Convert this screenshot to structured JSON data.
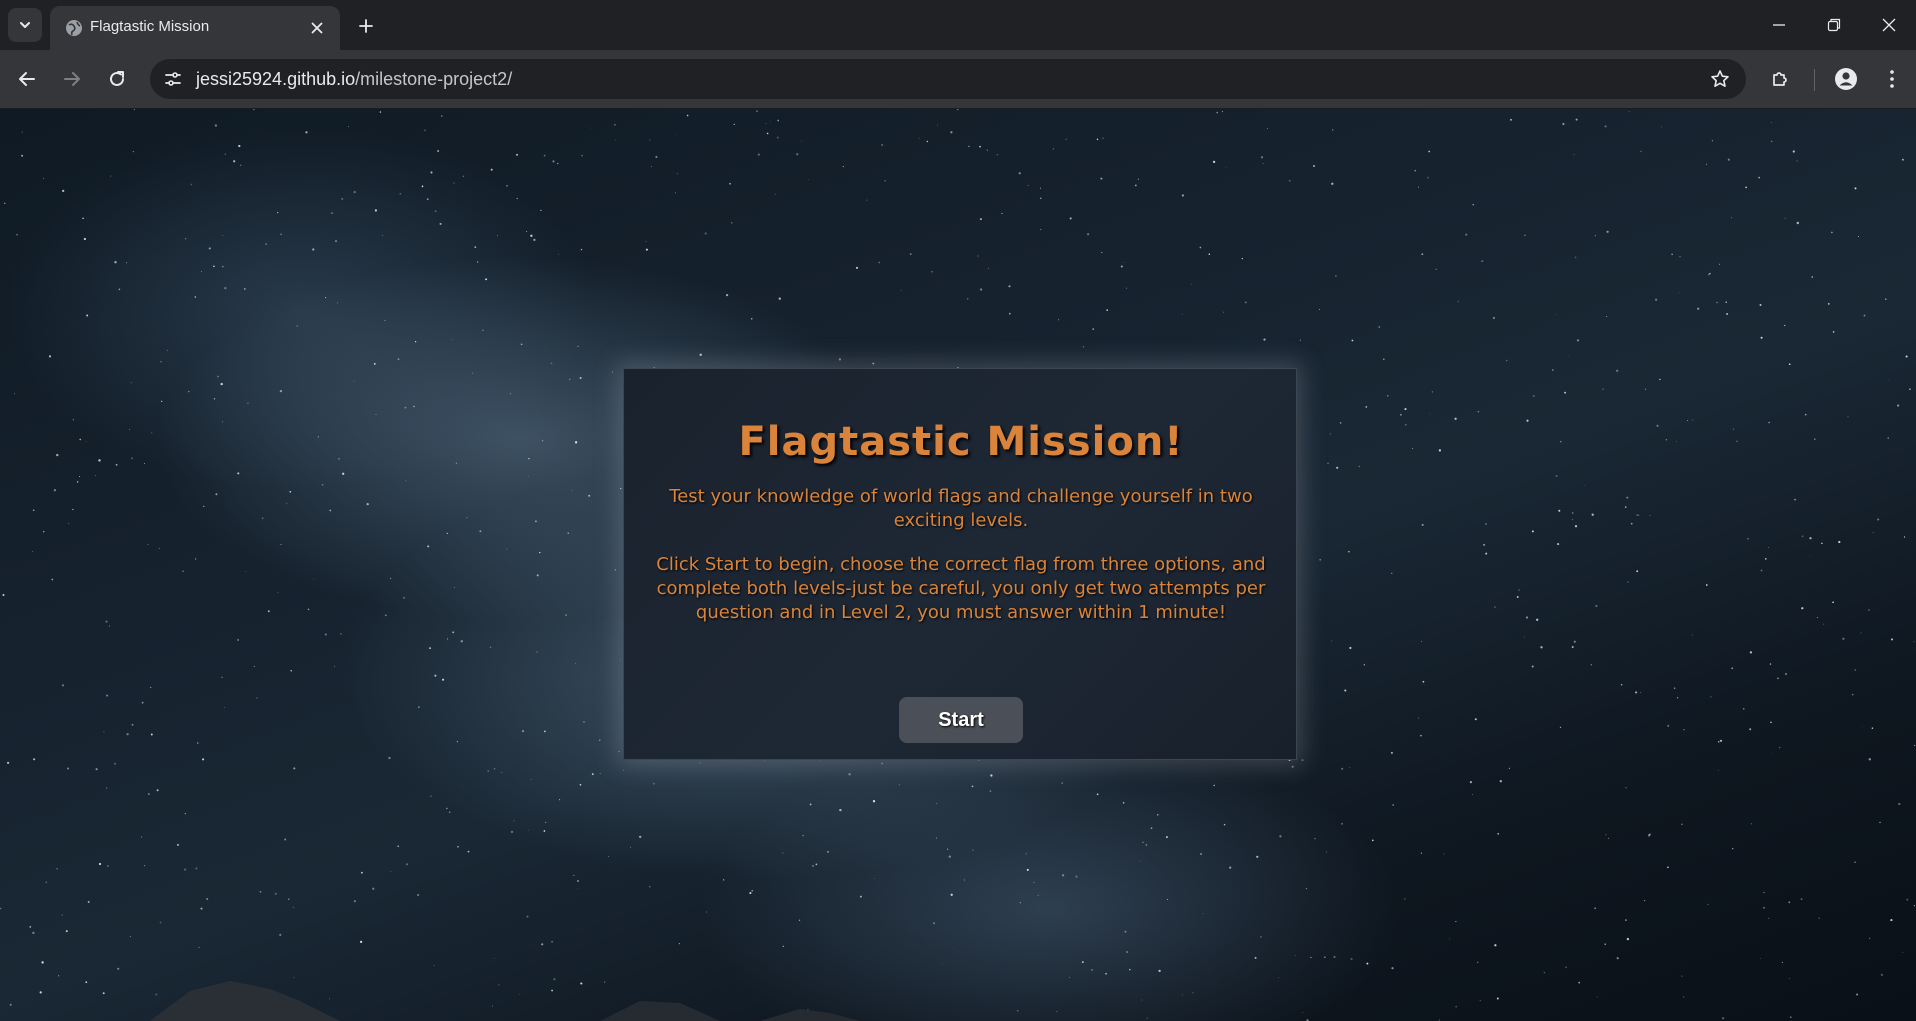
{
  "browser": {
    "tab_title": "Flagtastic Mission",
    "url_domain": "jessi25924.github.io",
    "url_path": "/milestone-project2/",
    "icons": {
      "tab_search": "chevron-down-icon",
      "favicon": "globe-icon",
      "tab_close": "close-icon",
      "new_tab": "plus-icon",
      "minimize": "minimize-icon",
      "restore": "restore-icon",
      "close_window": "close-icon",
      "back": "arrow-left-icon",
      "forward": "arrow-right-icon",
      "reload": "reload-icon",
      "site_info": "tune-icon",
      "bookmark": "star-icon",
      "extensions": "puzzle-icon",
      "profile": "person-icon",
      "menu": "kebab-menu-icon"
    }
  },
  "page": {
    "title": "Flagtastic Mission!",
    "intro": "Test your knowledge of world flags and challenge yourself in two exciting levels.",
    "instructions": "Click Start to begin, choose the correct flag from three options, and complete both levels-just be careful, you only get two attempts per question and in Level 2, you must answer within 1 minute!",
    "start_label": "Start"
  },
  "colors": {
    "accent": "#d9843a",
    "card_bg": "#1e2835",
    "button_bg": "#4b4f57"
  }
}
